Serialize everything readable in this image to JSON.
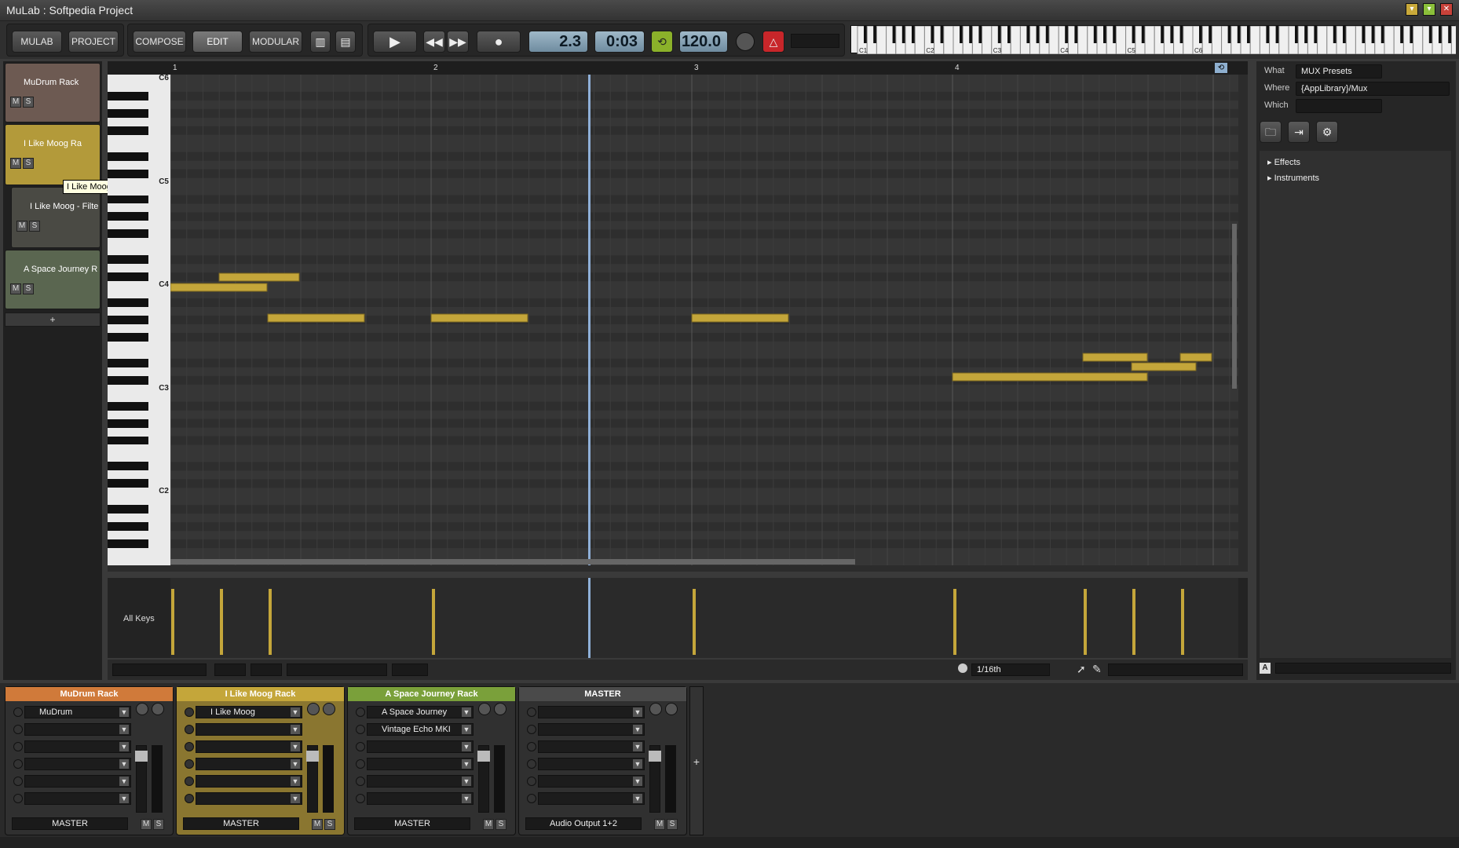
{
  "window": {
    "title": "MuLab : Softpedia Project"
  },
  "toolbar": {
    "mulab": "MULAB",
    "project": "PROJECT",
    "compose": "COMPOSE",
    "edit": "EDIT",
    "modular": "MODULAR",
    "position": "2.3",
    "time": "0:03",
    "tempo": "120.0"
  },
  "keyboard": {
    "octave_labels": [
      "C1",
      "C2",
      "C3",
      "C4",
      "C5",
      "C6"
    ]
  },
  "tracks": [
    {
      "name": "MuDrum Rack",
      "color": "#6d5a52"
    },
    {
      "name": "I Like Moog Ra",
      "color": "#b39a3a"
    },
    {
      "name": "I Like Moog - Filte",
      "color": "#4a4a44"
    },
    {
      "name": "A Space Journey R",
      "color": "#5a6650"
    }
  ],
  "track_add": "+",
  "ms": {
    "m": "M",
    "s": "S"
  },
  "tooltip": "I Like Moog Rack",
  "ruler": {
    "bars": [
      "1",
      "2",
      "3",
      "4"
    ]
  },
  "pitch_labels": [
    "C6",
    "C5",
    "C4",
    "C3",
    "C2"
  ],
  "velocity_label": "All Keys",
  "grid_value": "1/16th",
  "browser": {
    "what_label": "What",
    "what_value": "MUX Presets",
    "where_label": "Where",
    "where_value": "{AppLibrary}/Mux",
    "which_label": "Which",
    "which_value": "",
    "tree": [
      "Effects",
      "Instruments"
    ],
    "footer_letter": "A"
  },
  "mixer": {
    "strips": [
      {
        "title": "MuDrum Rack",
        "color": "#d07a3a",
        "slot1": "MuDrum",
        "slot2": "",
        "output": "MASTER"
      },
      {
        "title": "I Like Moog Rack",
        "color": "#c4a63a",
        "slot1": "I Like Moog",
        "slot2": "",
        "output": "MASTER"
      },
      {
        "title": "A Space Journey Rack",
        "color": "#7aa03a",
        "slot1": "A Space Journey",
        "slot2": "Vintage Echo MKI",
        "output": "MASTER"
      },
      {
        "title": "MASTER",
        "color": "#4a4a4a",
        "slot1": "",
        "slot2": "",
        "output": "Audio Output 1+2"
      }
    ],
    "add": "+"
  }
}
